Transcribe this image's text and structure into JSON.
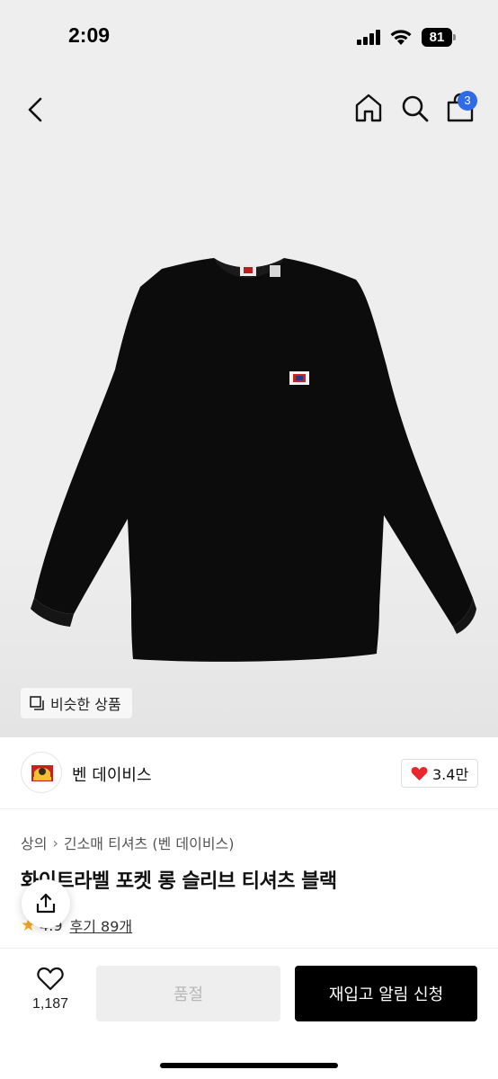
{
  "status_bar": {
    "time": "2:09",
    "battery": "81"
  },
  "header": {
    "back_icon": "chevron-left-icon",
    "home_icon": "home-icon",
    "search_icon": "search-icon",
    "cart_icon": "shopping-bag-icon",
    "cart_count": "3"
  },
  "gallery": {
    "similar_products_label": "비슷한 상품",
    "similar_icon": "copy-icon"
  },
  "brand": {
    "name": "벤 데이비스",
    "likes": "3.4만"
  },
  "product": {
    "breadcrumb": [
      "상의",
      "긴소매 티셔츠 (벤 데이비스)"
    ],
    "title": "화이트라벨 포켓 롱 슬리브 티셔츠 블랙",
    "rating": "4.9",
    "reviews_label": "후기 89개"
  },
  "bottom_bar": {
    "wish_count": "1,187",
    "soldout_label": "품절",
    "restock_label": "재입고 알림 신청"
  },
  "colors": {
    "accent_badge": "#2f6be8",
    "heart": "#e8262e",
    "star": "#f5a623",
    "primary_button": "#000000",
    "disabled_button": "#eeeeee"
  }
}
